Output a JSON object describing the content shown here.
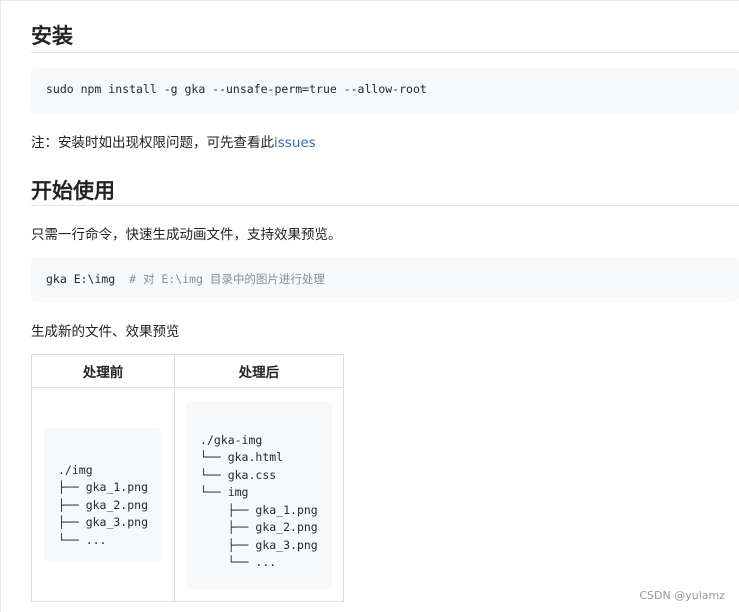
{
  "section_install": {
    "heading": "安装",
    "command": "sudo npm install -g gka --unsafe-perm=true --allow-root",
    "note_prefix": "注：安装时如出现权限问题，可先查看此",
    "note_link": "issues"
  },
  "section_start": {
    "heading": "开始使用",
    "description": "只需一行命令，快速生成动画文件，支持效果预览。",
    "command": "gka E:\\img",
    "comment": "# 对 E:\\img 目录中的图片进行处理",
    "result_text": "生成新的文件、效果预览"
  },
  "table": {
    "headers": [
      "处理前",
      "处理后"
    ],
    "before_tree": "./img\n├── gka_1.png\n├── gka_2.png\n├── gka_3.png\n└── ...",
    "after_tree": "./gka-img\n└── gka.html\n└── gka.css\n└── img\n    ├── gka_1.png\n    ├── gka_2.png\n    ├── gka_3.png\n    └── ..."
  },
  "watermark": "CSDN @yulamz"
}
